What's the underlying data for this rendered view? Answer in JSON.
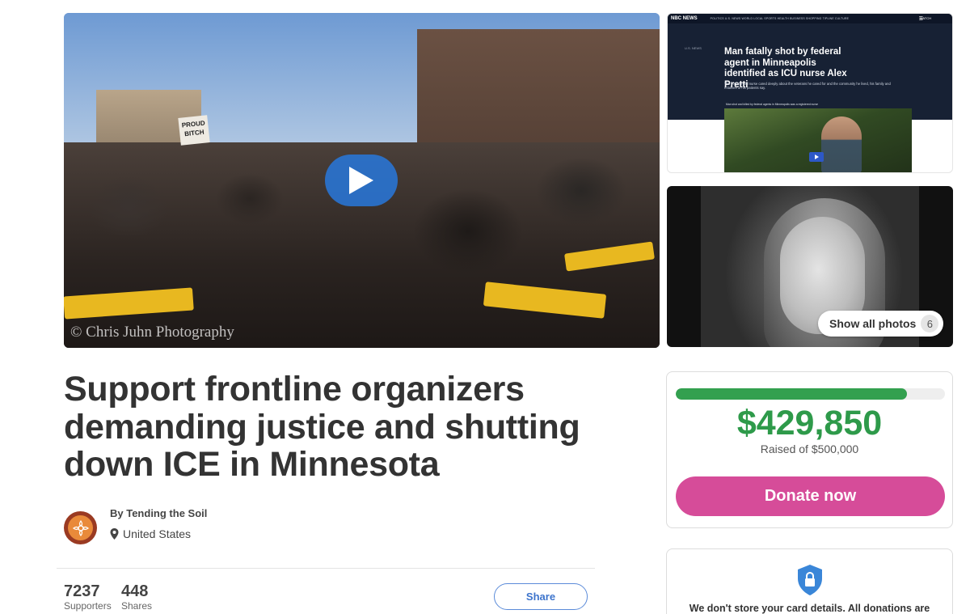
{
  "hero": {
    "watermark": "© Chris Juhn Photography",
    "sign_text": "PROUD BITCH",
    "play_icon": "play-icon"
  },
  "news_thumb": {
    "logo": "NBC NEWS",
    "nav_links": "POLITICS  U.S. NEWS  WORLD  LOCAL  SPORTS  HEALTH  BUSINESS  SHOPPING  TIPLINE  CULTURE",
    "watch": "WATCH",
    "section": "U.S. NEWS",
    "headline": "Man fatally shot by federal agent in Minneapolis identified as ICU nurse Alex Pretti",
    "dek": "The 37-year-old nurse cared deeply about the veterans he cared for and the community he lived, his family and relatives of his patients say.",
    "caption": "Man shot and killed by federal agents in Minneapolis was a registered nurse"
  },
  "gallery": {
    "show_all_label": "Show all photos",
    "photo_count": "6"
  },
  "campaign": {
    "title": "Support frontline organizers demanding justice and shutting down ICE in Minnesota",
    "organizer": "By Tending the Soil",
    "location": "United States"
  },
  "stats": {
    "supporters_count": "7237",
    "supporters_label": "Supporters",
    "shares_count": "448",
    "shares_label": "Shares",
    "share_button": "Share"
  },
  "donation": {
    "amount_raised": "$429,850",
    "goal_text": "Raised of $500,000",
    "progress_fraction": 0.86,
    "donate_button": "Donate now",
    "accent_green": "#2e9a4a",
    "donate_pink": "#d64c99"
  },
  "security": {
    "text": "We don't store your card details. All donations are",
    "icon": "lock-shield-icon"
  }
}
